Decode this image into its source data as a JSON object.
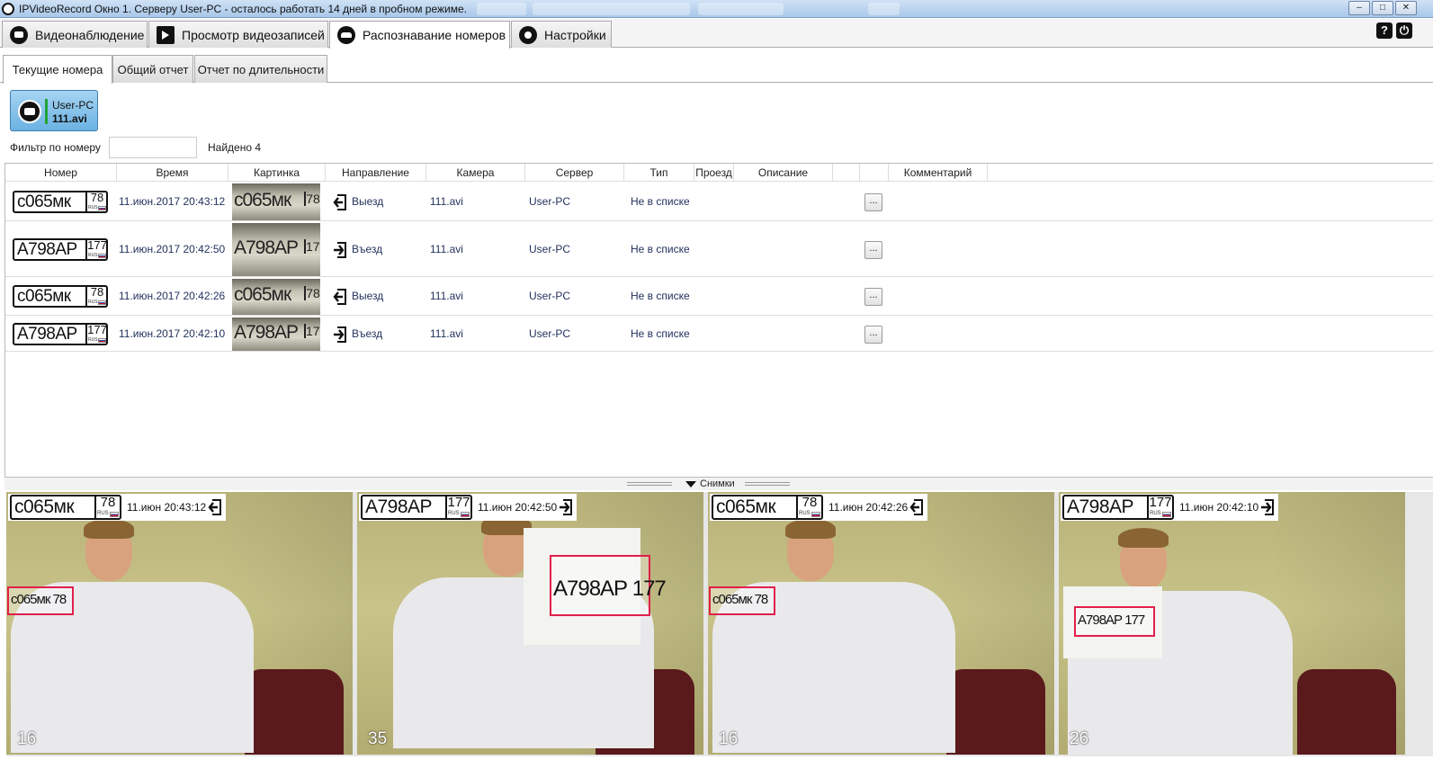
{
  "window": {
    "title": "IPVideoRecord Окно 1. Серверу User-PC - осталось работать 14 дней в пробном режиме.",
    "controls": {
      "minimize": "–",
      "maximize": "□",
      "close": "✕"
    }
  },
  "main_tabs": [
    {
      "label": "Видеонаблюдение",
      "icon": "monitor-icon"
    },
    {
      "label": "Просмотр видеозаписей",
      "icon": "film-icon"
    },
    {
      "label": "Распознавание номеров",
      "icon": "car-icon",
      "active": true
    },
    {
      "label": "Настройки",
      "icon": "gear-icon"
    }
  ],
  "help": {
    "label": "?",
    "power": "⏻"
  },
  "sub_tabs": [
    {
      "label": "Текущие номера",
      "active": true
    },
    {
      "label": "Общий отчет"
    },
    {
      "label": "Отчет по длительности"
    }
  ],
  "camera": {
    "server": "User-PC",
    "file": "111.avi"
  },
  "filter": {
    "label": "Фильтр по номеру",
    "value": "",
    "found": "Найдено 4"
  },
  "table": {
    "columns": [
      "Номер",
      "Время",
      "Картинка",
      "Направление",
      "Камера",
      "Сервер",
      "Тип",
      "Проезд",
      "Описание",
      "",
      "Комментарий"
    ],
    "rows": [
      {
        "plate": "с065мк",
        "region": "78",
        "rus": "RUS",
        "time": "11.июн.2017 20:43:12",
        "direction": "Выезд",
        "dir": "out",
        "camera": "111.avi",
        "server": "User-PC",
        "type": "Не в списке",
        "more": "..."
      },
      {
        "plate": "А798АР",
        "region": "177",
        "rus": "RUS",
        "time": "11.июн.2017 20:42:50",
        "direction": "Въезд",
        "dir": "in",
        "camera": "111.avi",
        "server": "User-PC",
        "type": "Не в списке",
        "more": "..."
      },
      {
        "plate": "с065мк",
        "region": "78",
        "rus": "RUS",
        "time": "11.июн.2017 20:42:26",
        "direction": "Выезд",
        "dir": "out",
        "camera": "111.avi",
        "server": "User-PC",
        "type": "Не в списке",
        "more": "..."
      },
      {
        "plate": "А798АР",
        "region": "177",
        "rus": "RUS",
        "time": "11.июн.2017 20:42:10",
        "direction": "Въезд",
        "dir": "in",
        "camera": "111.avi",
        "server": "User-PC",
        "type": "Не в списке",
        "more": "..."
      }
    ]
  },
  "snapshots_label": "Снимки",
  "snapshots": [
    {
      "plate": "с065мк",
      "region": "78",
      "rus": "RUS",
      "time": "11.июн 20:43:12",
      "dir": "out",
      "count": "16",
      "detected": "с065мк 78"
    },
    {
      "plate": "А798АР",
      "region": "177",
      "rus": "RUS",
      "time": "11.июн 20:42:50",
      "dir": "in",
      "count": "35",
      "detected": "А798АР 177"
    },
    {
      "plate": "с065мк",
      "region": "78",
      "rus": "RUS",
      "time": "11.июн 20:42:26",
      "dir": "out",
      "count": "16",
      "detected": "с065мк 78"
    },
    {
      "plate": "А798АР",
      "region": "177",
      "rus": "RUS",
      "time": "11.июн 20:42:10",
      "dir": "in",
      "count": "26",
      "detected": "А798АР 177"
    }
  ]
}
